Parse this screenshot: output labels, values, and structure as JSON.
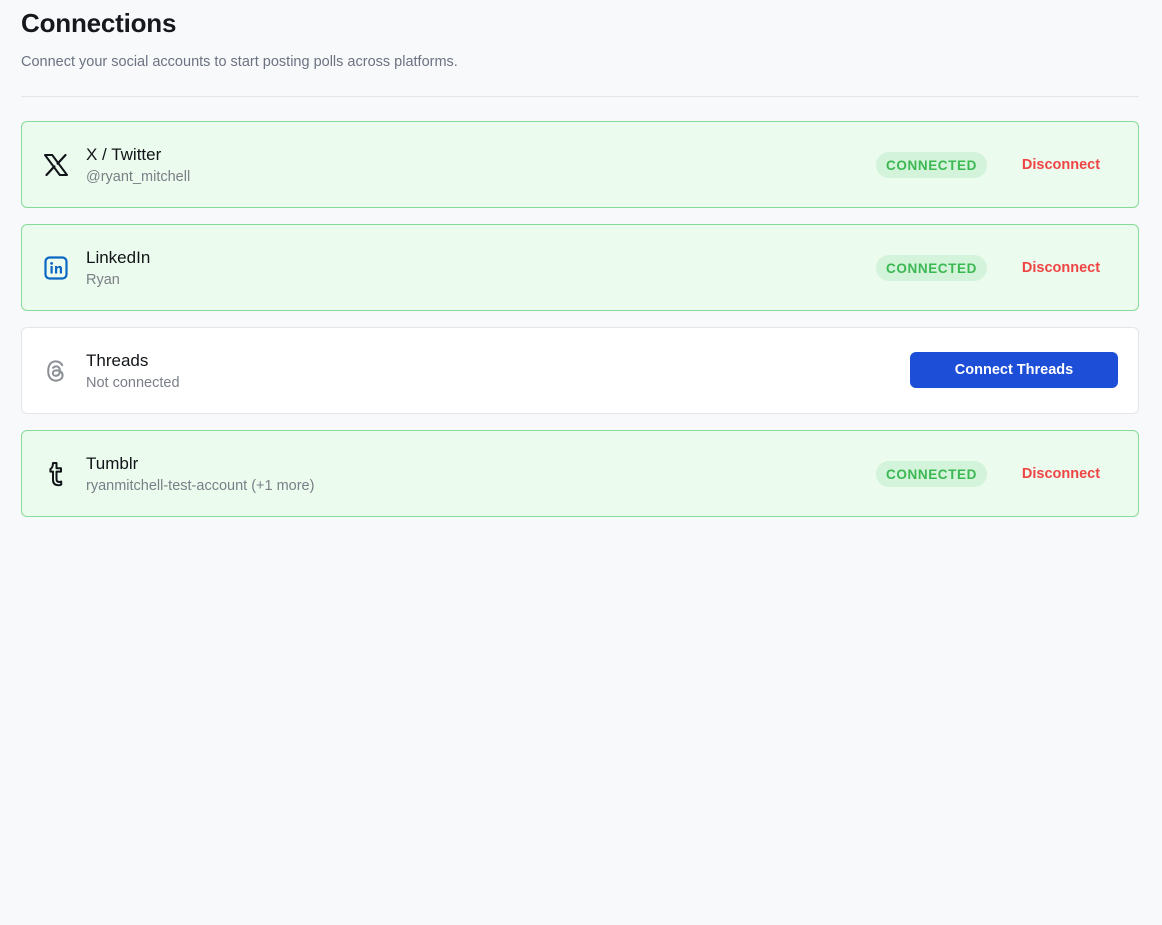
{
  "header": {
    "title": "Connections",
    "subtitle": "Connect your social accounts to start posting polls across platforms."
  },
  "connections": [
    {
      "platform": "X / Twitter",
      "account": "@ryant_mitchell",
      "icon": "x-twitter-icon",
      "status": "CONNECTED",
      "action_label": "Disconnect"
    },
    {
      "platform": "LinkedIn",
      "account": "Ryan",
      "icon": "linkedin-icon",
      "status": "CONNECTED",
      "action_label": "Disconnect"
    },
    {
      "platform": "Threads",
      "account": "Not connected",
      "icon": "threads-icon",
      "action_label": "Connect Threads"
    },
    {
      "platform": "Tumblr",
      "account": "ryanmitchell-test-account (+1 more)",
      "icon": "tumblr-icon",
      "status": "CONNECTED",
      "action_label": "Disconnect"
    }
  ],
  "colors": {
    "connected_bg": "#ebfbee",
    "connected_border": "#86dc97",
    "badge_text": "#3cb853",
    "disconnect": "#ef4444",
    "primary_button": "#1d4ed8",
    "linkedin_blue": "#0a66c2"
  }
}
